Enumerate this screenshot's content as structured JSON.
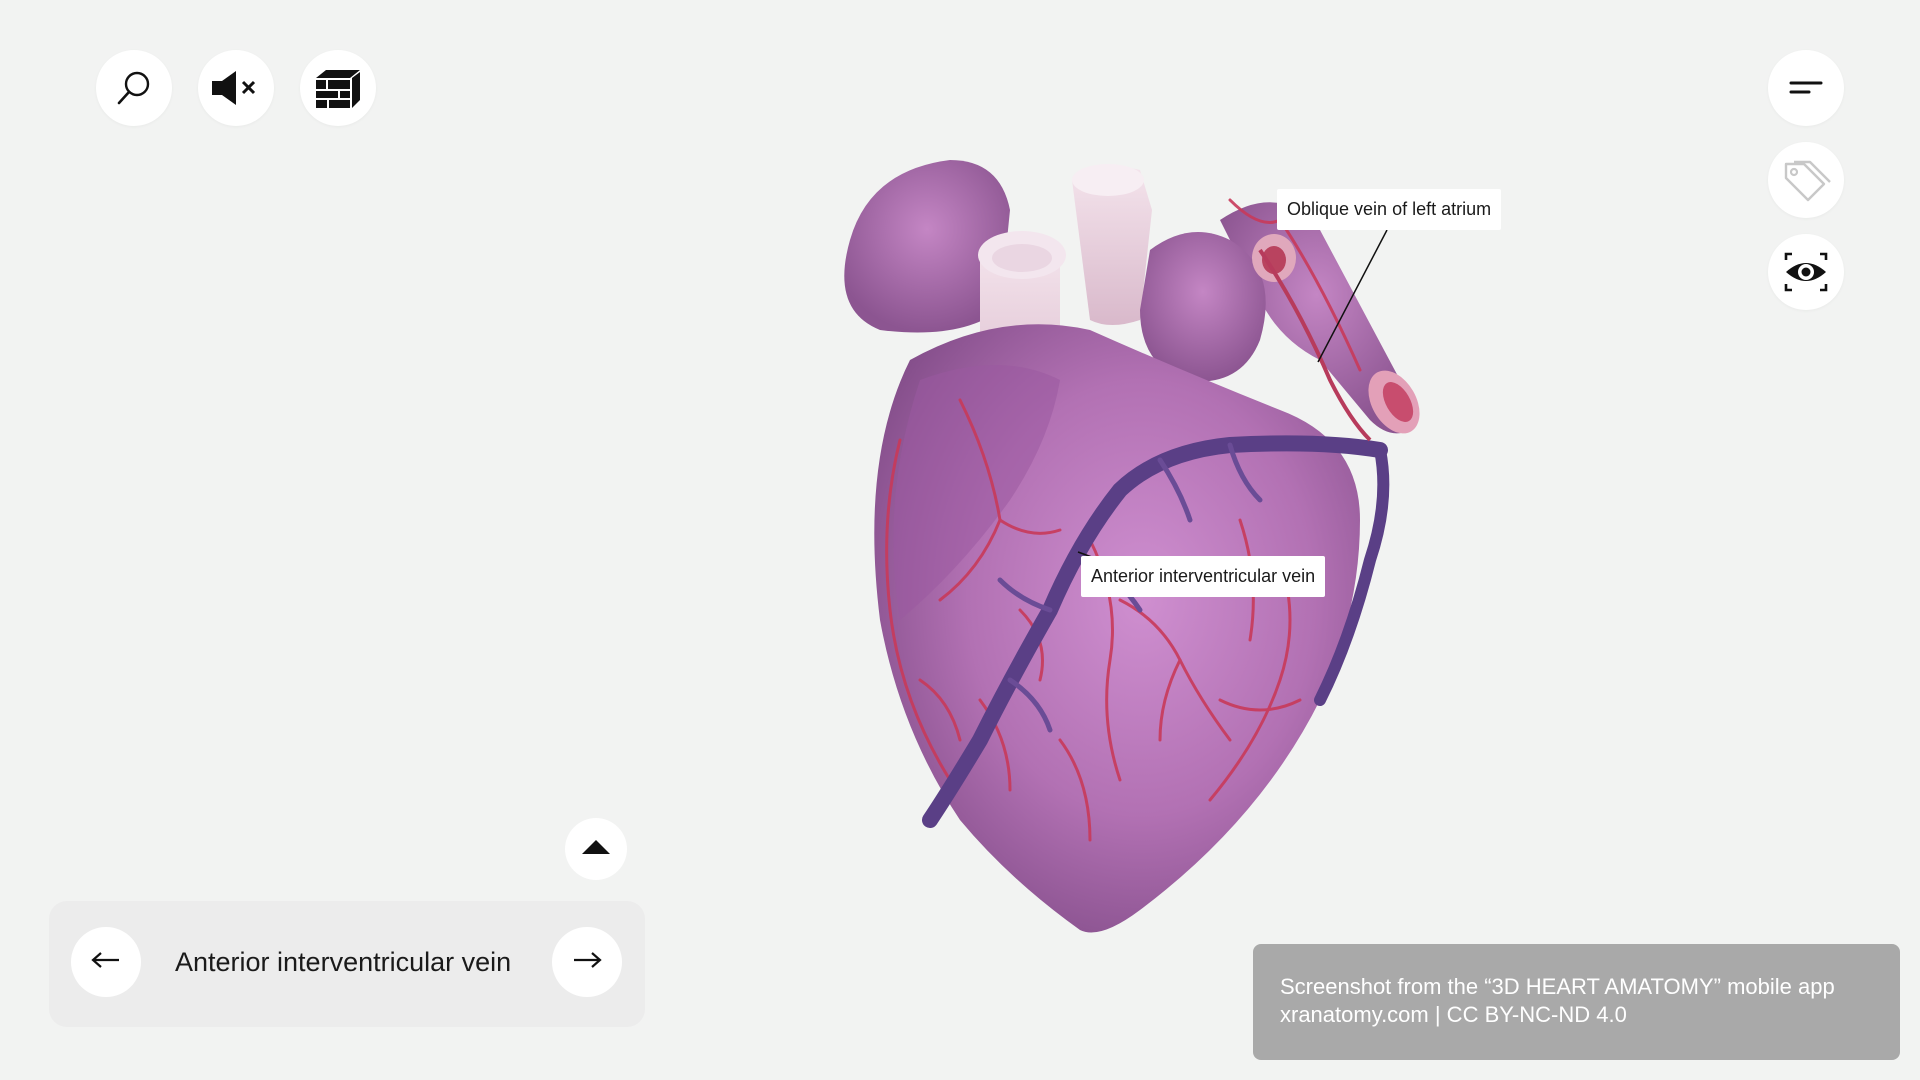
{
  "toolbar_left": {
    "search_icon": "search-icon",
    "mute_icon": "speaker-muted-icon",
    "layers_icon": "layers-icon"
  },
  "toolbar_right": {
    "menu_icon": "menu-icon",
    "tags_icon": "tag-icon",
    "view_icon": "eye-focus-icon"
  },
  "model": {
    "labels": [
      {
        "text": "Oblique vein of left atrium"
      },
      {
        "text": "Anterior interventricular vein"
      }
    ]
  },
  "navigation": {
    "title": "Anterior interventricular vein",
    "prev_icon": "arrow-left-icon",
    "next_icon": "arrow-right-icon",
    "expand_icon": "triangle-up-icon"
  },
  "credit": {
    "line1": "Screenshot from the “3D HEART AMATOMY” mobile app",
    "line2": "xranatomy.com | CC BY-NC-ND 4.0"
  },
  "colors": {
    "background": "#f2f3f2",
    "heart_base": "#b56fb0",
    "vessel_red": "#c83a5a",
    "vein_purple": "#5a3f86",
    "credit_bg": "#a9a9a9"
  }
}
